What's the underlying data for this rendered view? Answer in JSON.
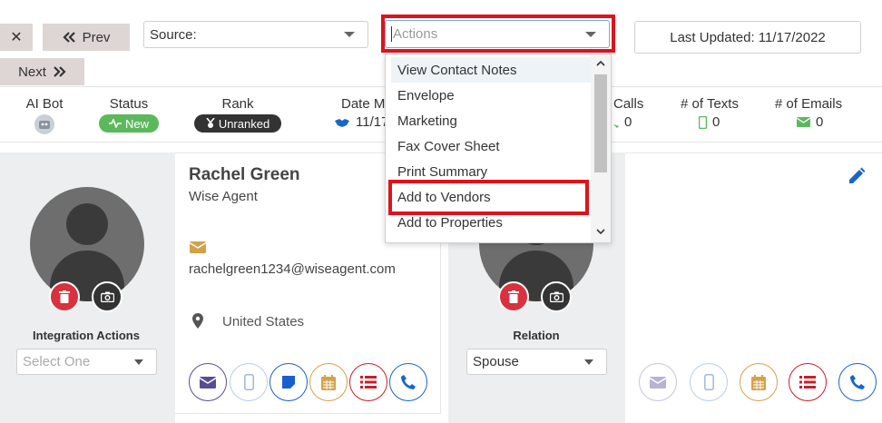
{
  "nav": {
    "close_symbol": "✕",
    "prev_label": "Prev",
    "next_label": "Next",
    "source_label": "Source:",
    "actions_placeholder": "Actions",
    "last_updated": "Last Updated: 11/17/2022"
  },
  "stats": {
    "ai_bot_label": "AI Bot",
    "status_label": "Status",
    "status_value": "New",
    "rank_label": "Rank",
    "rank_value": "Unranked",
    "date_label": "Date M",
    "date_value": "11/17/",
    "calls_label": "Calls",
    "calls_value": "0",
    "texts_label": "# of Texts",
    "texts_value": "0",
    "emails_label": "# of Emails",
    "emails_value": "0"
  },
  "contact": {
    "name": "Rachel Green",
    "company": "Wise Agent",
    "email": "rachelgreen1234@wiseagent.com",
    "location": "United States",
    "integration_label": "Integration Actions",
    "integration_placeholder": "Select One"
  },
  "relation": {
    "label": "Relation",
    "value": "Spouse"
  },
  "actions_menu": {
    "items": [
      "View Contact Notes",
      "Envelope",
      "Marketing",
      "Fax Cover Sheet",
      "Print Summary",
      "Add to Vendors",
      "Add to Properties"
    ]
  },
  "colors": {
    "highlight_red": "#e0121b",
    "status_green": "#5cb85c",
    "rank_dark": "#333333",
    "email_purple": "#5a4d96",
    "note_blue": "#1a5fd0",
    "calendar_gold": "#d4a24c",
    "list_red": "#c8202a",
    "phone_blue": "#1a66c8",
    "edit_blue": "#1a66c8"
  }
}
